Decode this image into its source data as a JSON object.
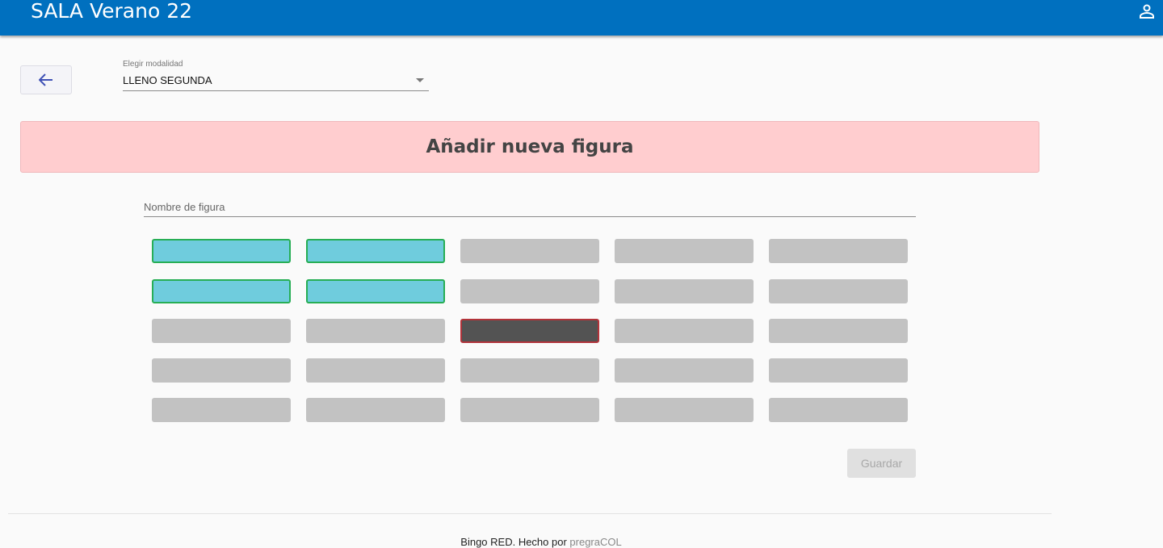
{
  "header": {
    "title": "SALA Verano 22",
    "user_icon": "account-icon",
    "color": "#0070bf"
  },
  "toolbar": {
    "back_icon": "arrow-left-icon",
    "mode_label": "Elegir modalidad",
    "mode_value": "LLENO SEGUNDA"
  },
  "banner": {
    "title": "Añadir nueva figura",
    "color": "#ffcdcf"
  },
  "form": {
    "name_placeholder": "Nombre de figura",
    "name_value": "",
    "grid": [
      [
        "selected",
        "selected",
        "off",
        "off",
        "off"
      ],
      [
        "selected",
        "selected",
        "off",
        "off",
        "off"
      ],
      [
        "off",
        "off",
        "free",
        "off",
        "off"
      ],
      [
        "off",
        "off",
        "off",
        "off",
        "off"
      ],
      [
        "off",
        "off",
        "off",
        "off",
        "off"
      ]
    ],
    "save_label": "Guardar",
    "save_disabled": true
  },
  "footer": {
    "text": "Bingo RED. Hecho por ",
    "link": "pregraCOL"
  }
}
